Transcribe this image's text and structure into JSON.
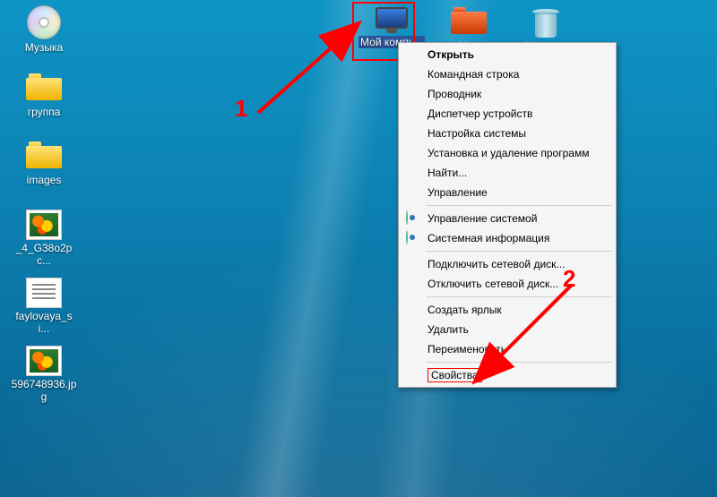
{
  "desktop_icons": {
    "music": {
      "label": "Музыка"
    },
    "group": {
      "label": "группа"
    },
    "images": {
      "label": "images"
    },
    "photo1": {
      "label": "_4_G38o2pc..."
    },
    "textfile": {
      "label": "faylovaya_si..."
    },
    "photo2": {
      "label": "596748936.jpg"
    },
    "mycomputer": {
      "label": "Мой компь..."
    },
    "mydocs": {
      "label": "Мои"
    },
    "recycle": {
      "label": "Корзина"
    }
  },
  "context_menu": {
    "open": "Открыть",
    "cmd": "Командная строка",
    "explorer": "Проводник",
    "devmgr": "Диспетчер устройств",
    "sysconfig": "Настройка системы",
    "addremove": "Установка и удаление программ",
    "find": "Найти...",
    "manage": "Управление",
    "sysmanage": "Управление системой",
    "sysinfo": "Системная информация",
    "mapdrive": "Подключить сетевой диск...",
    "unmapdrive": "Отключить сетевой диск...",
    "shortcut": "Создать ярлык",
    "delete": "Удалить",
    "rename": "Переименовать",
    "properties": "Свойства"
  },
  "annotations": {
    "one": "1",
    "two": "2"
  },
  "colors": {
    "accent_red": "#ff0000"
  }
}
